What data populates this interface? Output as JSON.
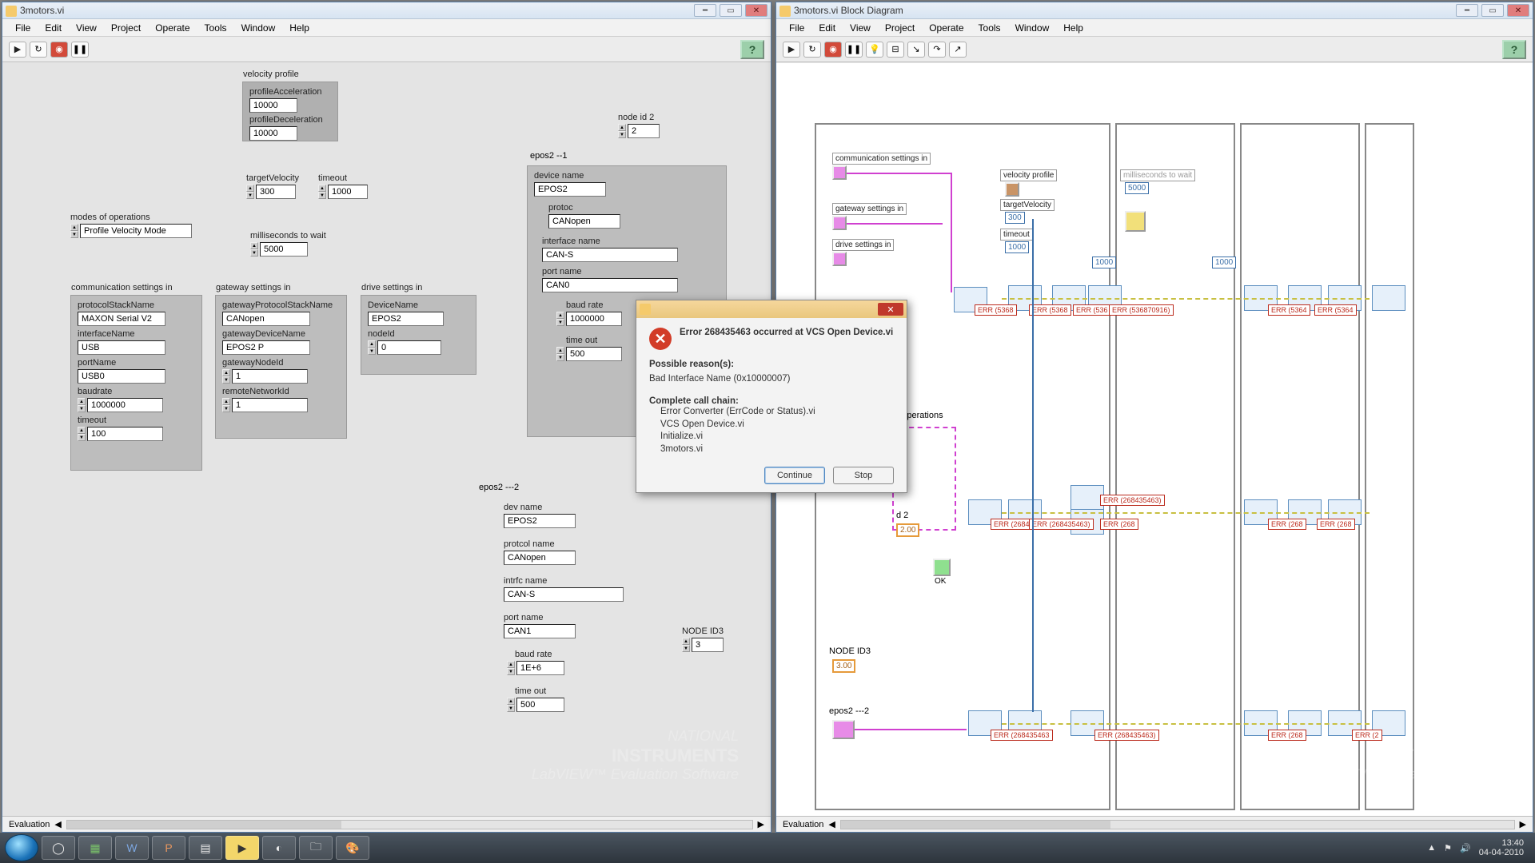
{
  "taskbar": {
    "time": "13:40",
    "date": "04-04-2010"
  },
  "windowFront": {
    "title": "3motors.vi",
    "menu": [
      "File",
      "Edit",
      "View",
      "Project",
      "Operate",
      "Tools",
      "Window",
      "Help"
    ],
    "status": "Evaluation",
    "watermark1": "NATIONAL",
    "watermark2": "INSTRUMENTS",
    "watermark3": "LabVIEW™ Evaluation Software",
    "velocityProfile": {
      "title": "velocity profile",
      "profileAcceleration": {
        "label": "profileAcceleration",
        "value": "10000"
      },
      "profileDeceleration": {
        "label": "profileDeceleration",
        "value": "10000"
      }
    },
    "targetVelocity": {
      "label": "targetVelocity",
      "value": "300"
    },
    "timeout": {
      "label": "timeout",
      "value": "1000"
    },
    "modes": {
      "label": "modes of operations",
      "value": "Profile Velocity Mode"
    },
    "msWait": {
      "label": "milliseconds to wait",
      "value": "5000"
    },
    "commSettings": {
      "title": "communication settings in",
      "protocolStackName": {
        "label": "protocolStackName",
        "value": "MAXON Serial V2"
      },
      "interfaceName": {
        "label": "interfaceName",
        "value": "USB"
      },
      "portName": {
        "label": "portName",
        "value": "USB0"
      },
      "baudrate": {
        "label": "baudrate",
        "value": "1000000"
      },
      "timeout": {
        "label": "timeout",
        "value": "100"
      }
    },
    "gatewaySettings": {
      "title": "gateway settings in",
      "gatewayProtocolStackName": {
        "label": "gatewayProtocolStackName",
        "value": "CANopen"
      },
      "gatewayDeviceName": {
        "label": "gatewayDeviceName",
        "value": "EPOS2 P"
      },
      "gatewayNodeId": {
        "label": "gatewayNodeId",
        "value": "1"
      },
      "remoteNetworkId": {
        "label": "remoteNetworkId",
        "value": "1"
      }
    },
    "driveSettings": {
      "title": "drive settings in",
      "DeviceName": {
        "label": "DeviceName",
        "value": "EPOS2"
      },
      "nodeId": {
        "label": "nodeId",
        "value": "0"
      }
    },
    "epos2_1": {
      "title": "epos2  --1",
      "deviceName": {
        "label": "device name",
        "value": "EPOS2"
      },
      "protoc": {
        "label": "protoc",
        "value": "CANopen"
      },
      "interfaceName": {
        "label": "interface name",
        "value": "CAN-S"
      },
      "portName": {
        "label": "port name",
        "value": "CAN0"
      },
      "baudRate": {
        "label": "baud rate",
        "value": "1000000"
      },
      "timeOut": {
        "label": "time out",
        "value": "500"
      }
    },
    "nodeId2": {
      "label": "node id 2",
      "value": "2"
    },
    "epos2_2": {
      "title": "epos2 ---2",
      "devName": {
        "label": "dev name",
        "value": "EPOS2"
      },
      "protcol": {
        "label": "protcol name",
        "value": "CANopen"
      },
      "intrfc": {
        "label": "intrfc name",
        "value": "CAN-S"
      },
      "portName": {
        "label": "port name",
        "value": "CAN1"
      },
      "baudRate": {
        "label": "baud rate",
        "value": "1E+6"
      },
      "timeOut": {
        "label": "time out",
        "value": "500"
      }
    },
    "nodeId3": {
      "label": "NODE ID3",
      "value": "3"
    }
  },
  "windowBlock": {
    "title": "3motors.vi Block Diagram",
    "menu": [
      "File",
      "Edit",
      "View",
      "Project",
      "Operate",
      "Tools",
      "Window",
      "Help"
    ],
    "status": "Evaluation",
    "labels": {
      "comm": "communication settings in",
      "gateway": "gateway settings in",
      "drive": "drive settings in",
      "velProfile": "velocity profile",
      "targetVel": "targetVelocity",
      "targetVelVal": "300",
      "timeout": "timeout",
      "timeoutVal": "1000",
      "msWait": "milliseconds to wait",
      "msWaitVal": "5000",
      "modes": "of operations",
      "ok": "OK",
      "const1": "1000",
      "const2": "1000",
      "nodeId2": "d 2",
      "nodeId2Val": "2.00",
      "nodeId3": "NODE ID3",
      "nodeId3Val": "3.00",
      "epos2_2": "epos2 ---2"
    },
    "errs": {
      "e1": "ERR (5368",
      "e2": "ERR (5368",
      "e3": "ERR (536",
      "e4": "ERR (536870916)",
      "e5": "ERR (5364",
      "e6": "ERR (5364",
      "r2a": "ERR (2684",
      "r2b": "ERR (268435463)",
      "r2c": "ERR (268",
      "r2d": "ERR (268435463)",
      "r2e": "ERR (268",
      "r2f": "ERR (268",
      "r3a": "ERR (268435463",
      "r3b": "ERR (268435463)",
      "r3c": "ERR (268",
      "r3d": "ERR (2"
    }
  },
  "errorDialog": {
    "heading": "Error 268435463 occurred at VCS Open Device.vi",
    "reasonsLabel": "Possible reason(s):",
    "reason": "Bad Interface Name (0x10000007)",
    "chainLabel": "Complete call chain:",
    "chain": [
      "Error Converter (ErrCode or Status).vi",
      "VCS Open Device.vi",
      "Initialize.vi",
      "3motors.vi"
    ],
    "continue": "Continue",
    "stop": "Stop"
  }
}
